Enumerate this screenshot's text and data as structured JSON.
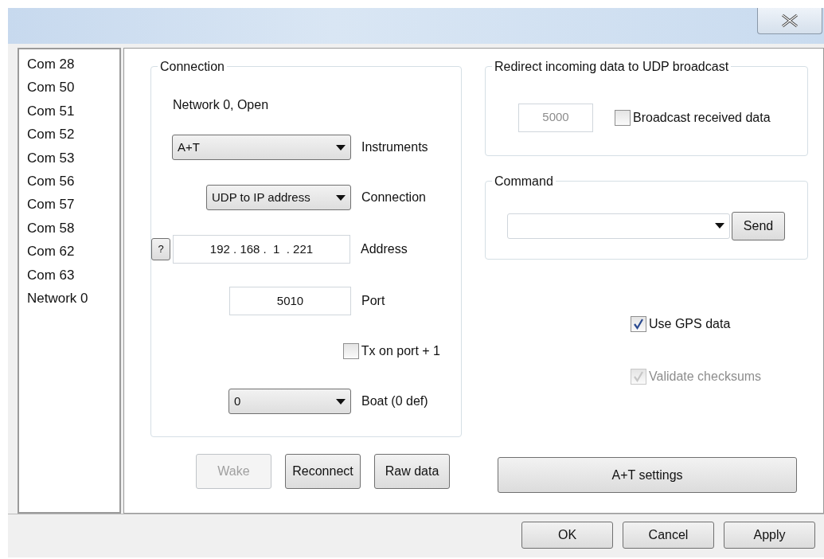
{
  "ports": [
    {
      "label": "Com 28",
      "selected": false
    },
    {
      "label": "Com 50",
      "selected": false
    },
    {
      "label": "Com 51",
      "selected": false
    },
    {
      "label": "Com 52",
      "selected": false
    },
    {
      "label": "Com 53",
      "selected": false
    },
    {
      "label": "Com 56",
      "selected": false
    },
    {
      "label": "Com 57",
      "selected": false
    },
    {
      "label": "Com 58",
      "selected": false
    },
    {
      "label": "Com 62",
      "selected": false
    },
    {
      "label": "Com 63",
      "selected": false
    },
    {
      "label": "Network 0",
      "selected": false
    }
  ],
  "connection": {
    "title": "Connection",
    "status": "Network 0, Open",
    "instruments": {
      "value": "A+T",
      "label": "Instruments"
    },
    "connection_type": {
      "value": "UDP to IP address",
      "label": "Connection"
    },
    "help_button": "?",
    "address": {
      "value": "192 . 168 .  1  . 221",
      "label": "Address"
    },
    "port": {
      "value": "5010",
      "label": "Port"
    },
    "tx_on_port": {
      "label": "Tx on port + 1",
      "checked": false
    },
    "boat": {
      "value": "0",
      "label": "Boat (0 def)"
    }
  },
  "redirect": {
    "title": "Redirect incoming data to UDP broadcast",
    "port": {
      "value": "5000",
      "disabled": true
    },
    "broadcast": {
      "label": "Broadcast received data",
      "checked": false
    }
  },
  "command": {
    "title": "Command",
    "send": "Send"
  },
  "options": [
    {
      "label": "Use GPS data",
      "checked": true,
      "disabled": false
    },
    {
      "label": "Validate checksums",
      "checked": true,
      "disabled": true
    }
  ],
  "actions": [
    {
      "label": "Wake",
      "disabled": true
    },
    {
      "label": "Reconnect",
      "disabled": false
    },
    {
      "label": "Raw data",
      "disabled": false
    }
  ],
  "settings_button": "A+T settings",
  "dialog_buttons": [
    "OK",
    "Cancel",
    "Apply"
  ]
}
